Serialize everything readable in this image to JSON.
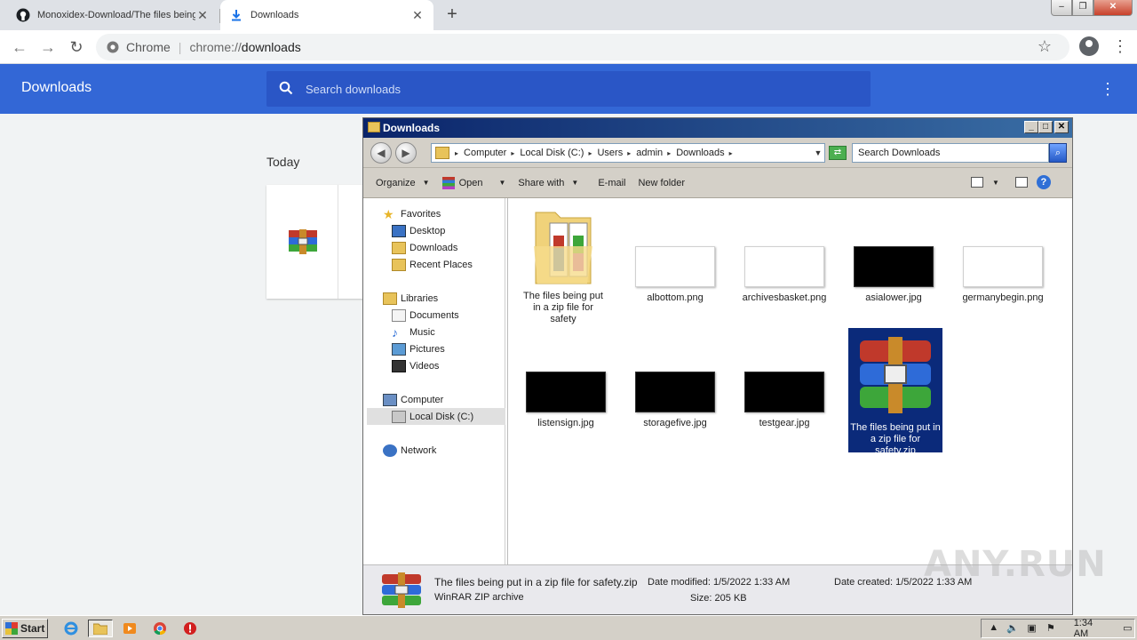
{
  "browser": {
    "tabs": [
      {
        "title": "Monoxidex-Download/The files being put in a zip file for safety",
        "icon": "github-icon"
      },
      {
        "title": "Downloads",
        "icon": "download-icon"
      }
    ],
    "omnibox": {
      "host": "Chrome",
      "url_scheme": "chrome://",
      "url_path": "downloads"
    },
    "downloads_page": {
      "title": "Downloads",
      "search_placeholder": "Search downloads",
      "section": "Today"
    }
  },
  "explorer": {
    "title": "Downloads",
    "breadcrumb": [
      "Computer",
      "Local Disk (C:)",
      "Users",
      "admin",
      "Downloads"
    ],
    "search_placeholder": "Search Downloads",
    "commands": {
      "organize": "Organize",
      "open": "Open",
      "share_with": "Share with",
      "email": "E-mail",
      "new_folder": "New folder"
    },
    "nav": {
      "favorites": "Favorites",
      "desktop": "Desktop",
      "downloads": "Downloads",
      "recent_places": "Recent Places",
      "libraries": "Libraries",
      "documents": "Documents",
      "music": "Music",
      "pictures": "Pictures",
      "videos": "Videos",
      "computer": "Computer",
      "local_disk": "Local Disk (C:)",
      "network": "Network"
    },
    "files": {
      "folder": "The files being put in a zip file for safety",
      "albottom": "albottom.png",
      "archivesbasket": "archivesbasket.png",
      "asialower": "asialower.jpg",
      "germanybegin": "germanybegin.png",
      "listensign": "listensign.jpg",
      "storagefive": "storagefive.jpg",
      "testgear": "testgear.jpg",
      "zip": "The files being put in a zip file for safety.zip"
    },
    "details": {
      "name": "The files being put in a zip file for safety.zip",
      "type": "WinRAR ZIP archive",
      "modified_label": "Date modified:",
      "modified": "1/5/2022 1:33 AM",
      "size_label": "Size:",
      "size": "205 KB",
      "created_label": "Date created:",
      "created": "1/5/2022 1:33 AM"
    }
  },
  "taskbar": {
    "start": "Start",
    "clock": "1:34 AM"
  },
  "watermark": "ANY.RUN"
}
